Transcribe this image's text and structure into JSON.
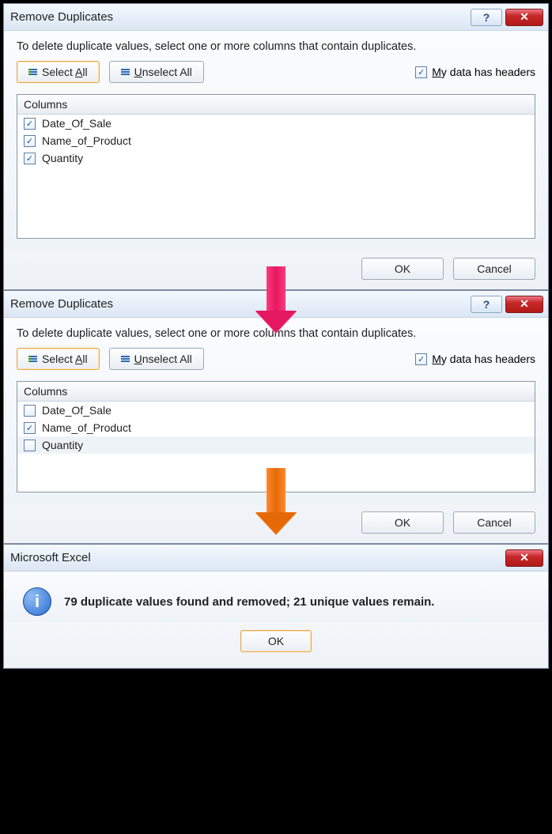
{
  "dialog1": {
    "title": "Remove Duplicates",
    "instruction": "To delete duplicate values, select one or more columns that contain duplicates.",
    "select_all_label_pre": "Select ",
    "select_all_key": "A",
    "select_all_label_post": "ll",
    "unselect_all_pre": "",
    "unselect_all_key": "U",
    "unselect_all_post": "nselect All",
    "headers_label_pre": "",
    "headers_label_key": "M",
    "headers_label_post": "y data has headers",
    "headers_checked": true,
    "columns_header": "Columns",
    "columns": [
      {
        "label": "Date_Of_Sale",
        "checked": true
      },
      {
        "label": "Name_of_Product",
        "checked": true
      },
      {
        "label": "Quantity",
        "checked": true
      }
    ],
    "ok": "OK",
    "cancel": "Cancel"
  },
  "dialog2": {
    "title": "Remove Duplicates",
    "instruction": "To delete duplicate values, select one or more columns that contain duplicates.",
    "select_all_label_pre": "Select ",
    "select_all_key": "A",
    "select_all_label_post": "ll",
    "unselect_all_pre": "",
    "unselect_all_key": "U",
    "unselect_all_post": "nselect All",
    "headers_label_pre": "",
    "headers_label_key": "M",
    "headers_label_post": "y data has headers",
    "headers_checked": true,
    "columns_header": "Columns",
    "columns": [
      {
        "label": "Date_Of_Sale",
        "checked": false
      },
      {
        "label": "Name_of_Product",
        "checked": true
      },
      {
        "label": "Quantity",
        "checked": false
      }
    ],
    "ok": "OK",
    "cancel": "Cancel"
  },
  "msgbox": {
    "title": "Microsoft Excel",
    "message": "79 duplicate values found and removed; 21 unique values remain.",
    "ok": "OK"
  },
  "icons": {
    "help": "?",
    "close": "✕",
    "check": "✓",
    "info": "i"
  }
}
